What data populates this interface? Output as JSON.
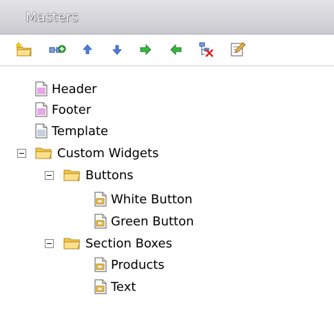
{
  "panel": {
    "title": "Masters"
  },
  "toolbar": {
    "buttons": [
      {
        "name": "new-folder",
        "icon": "new-folder-icon"
      },
      {
        "name": "add-master",
        "icon": "add-master-icon"
      },
      {
        "name": "move-up",
        "icon": "arrow-up-icon"
      },
      {
        "name": "move-down",
        "icon": "arrow-down-icon"
      },
      {
        "name": "indent",
        "icon": "arrow-right-icon"
      },
      {
        "name": "outdent",
        "icon": "arrow-left-icon"
      },
      {
        "name": "delete",
        "icon": "delete-icon"
      },
      {
        "name": "rename",
        "icon": "rename-icon"
      }
    ]
  },
  "tree": {
    "header": "Header",
    "footer": "Footer",
    "template": "Template",
    "custom_widgets": "Custom Widgets",
    "buttons": "Buttons",
    "white_button": "White Button",
    "green_button": "Green Button",
    "section_boxes": "Section Boxes",
    "products": "Products",
    "text": "Text"
  },
  "colors": {
    "title_bar": "#d4d4da",
    "master_page_pink": "#e6a7e6",
    "folder_yellow": "#f6cf5a"
  }
}
